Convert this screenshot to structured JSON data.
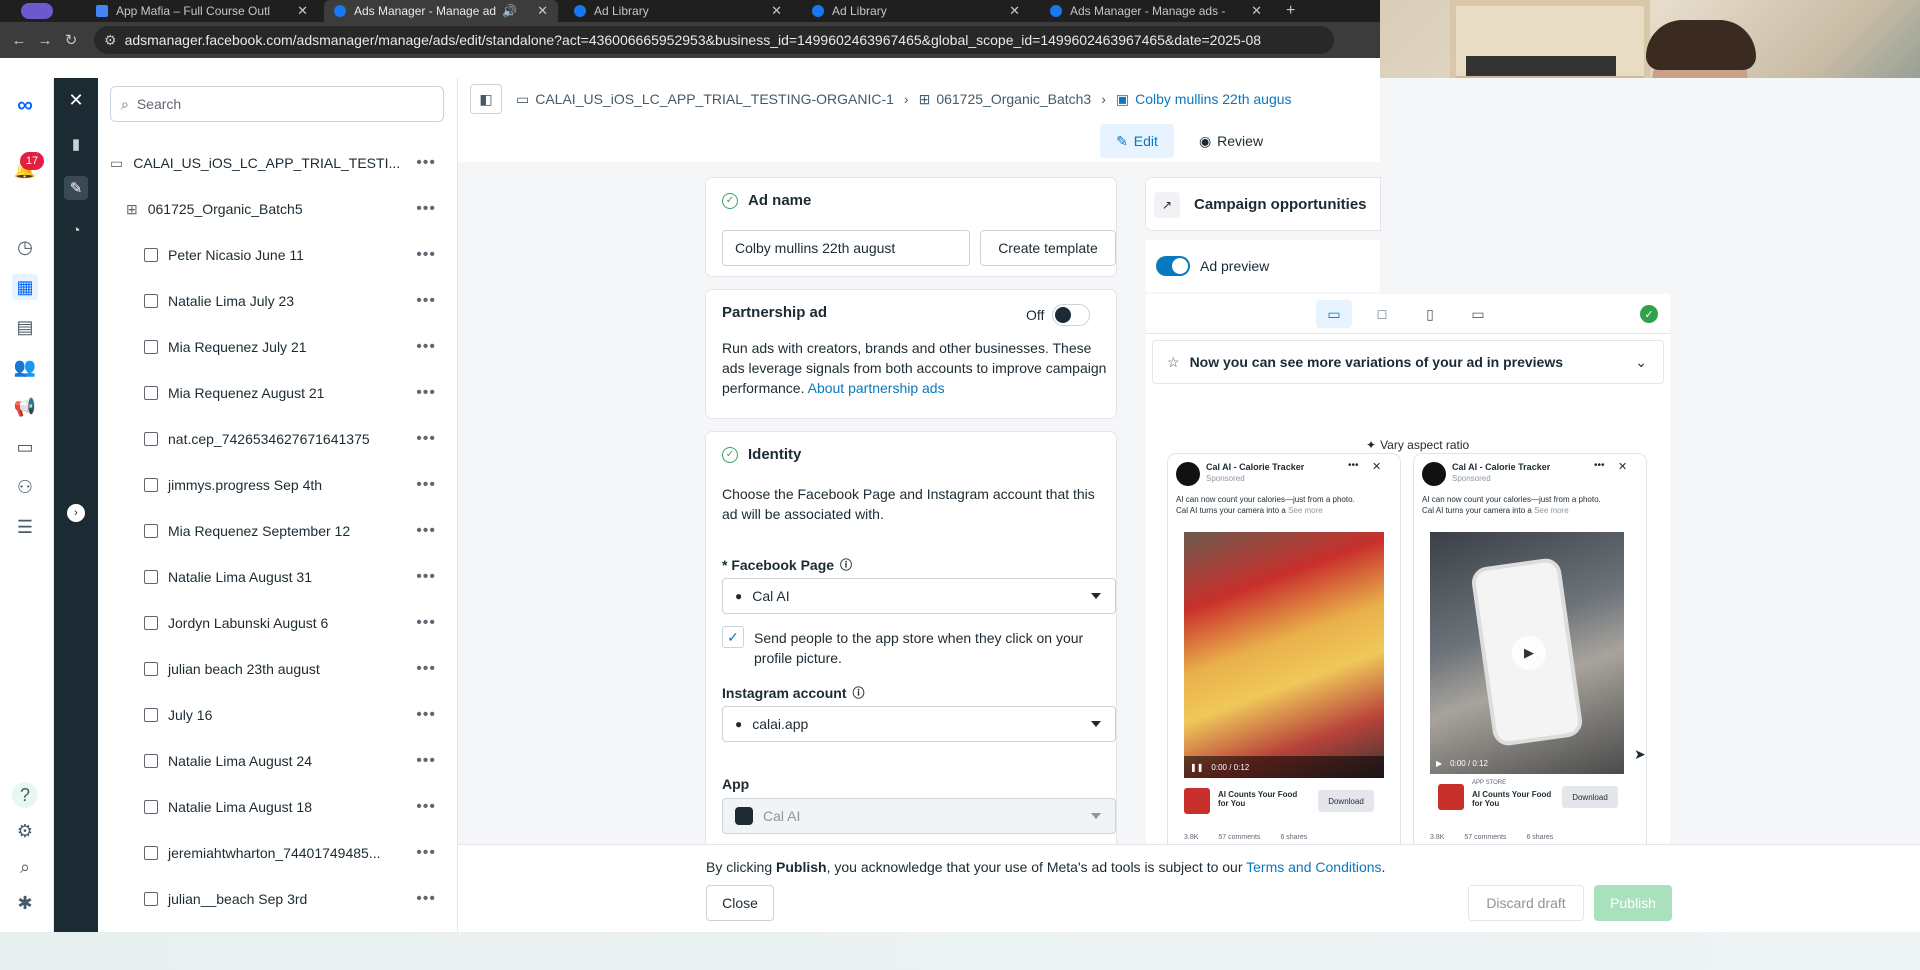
{
  "browser": {
    "tabs": [
      {
        "label": "App Mafia – Full Course Outl"
      },
      {
        "label": "Ads Manager - Manage ad"
      },
      {
        "label": "Ad Library"
      },
      {
        "label": "Ad Library"
      },
      {
        "label": "Ads Manager - Manage ads -"
      }
    ],
    "url_site": "adsmanager.facebook.com",
    "url": "adsmanager.facebook.com/adsmanager/manage/ads/edit/standalone?act=436006665952953&business_id=1499602463967465&global_scope_id=1499602463967465&date=2025-08"
  },
  "rail": {
    "notification_count": "17"
  },
  "tree": {
    "search_placeholder": "Search",
    "campaign": "CALAI_US_iOS_LC_APP_TRIAL_TESTI...",
    "adset": "061725_Organic_Batch5",
    "ads": [
      "Peter Nicasio June 11",
      "Natalie Lima July 23",
      "Mia Requenez July 21",
      "Mia Requenez August 21",
      "nat.cep_7426534627671641375",
      "jimmys.progress Sep 4th",
      "Mia Requenez September 12",
      "Natalie Lima August 31",
      "Jordyn Labunski August 6",
      "julian beach 23th august",
      "July 16",
      "Natalie Lima August 24",
      "Natalie Lima August 18",
      "jeremiahtwharton_74401749485...",
      "julian__beach Sep 3rd"
    ]
  },
  "breadcrumb": {
    "campaign": "CALAI_US_iOS_LC_APP_TRIAL_TESTING-ORGANIC-1",
    "adset": "061725_Organic_Batch3",
    "ad": "Colby mullins 22th augus"
  },
  "toolbar": {
    "edit": "Edit",
    "review": "Review"
  },
  "ad_name": {
    "label": "Ad name",
    "value": "Colby mullins 22th august",
    "create_template": "Create template"
  },
  "partnership": {
    "label": "Partnership ad",
    "toggle": "Off",
    "text": "Run ads with creators, brands and other businesses. These ads leverage signals from both accounts to improve campaign performance.",
    "link": "About partnership ads"
  },
  "identity": {
    "label": "Identity",
    "text": "Choose the Facebook Page and Instagram account that this ad will be associated with.",
    "fb_page_label": "* Facebook Page",
    "fb_page_value": "Cal AI",
    "checkbox_text": "Send people to the app store when they click on your profile picture.",
    "ig_label": "Instagram account",
    "ig_value": "calai.app",
    "app_label": "App",
    "app_value": "Cal AI"
  },
  "preview": {
    "campaign_opps": "Campaign opportunities",
    "ad_preview": "Ad preview",
    "banner": "Now you can see more variations of your ad in previews",
    "vary": "Vary aspect ratio",
    "page_name": "Cal AI - Calorie Tracker",
    "sponsored": "Sponsored",
    "caption1": "AI can now count your calories—just from a photo.",
    "caption2": "Cal AI turns your camera into a",
    "see_more": "See more",
    "cta_title": "AI Counts Your Food for You",
    "app_store": "APP STORE",
    "download": "Download",
    "time": "0:00 / 0:12",
    "reactions": "3.8K",
    "comments": "57 comments",
    "shares": "6 shares"
  },
  "footer": {
    "text_pre": "By clicking",
    "text_bold": "Publish",
    "text_post": ", you acknowledge that your use of Meta's ad tools is subject to our",
    "terms": "Terms and Conditions",
    "close": "Close",
    "discard": "Discard draft",
    "publish": "Publish"
  },
  "colors": {
    "accent": "#0a78be",
    "publish_disabled": "#a9e0bd",
    "notification": "#e41e3f"
  }
}
